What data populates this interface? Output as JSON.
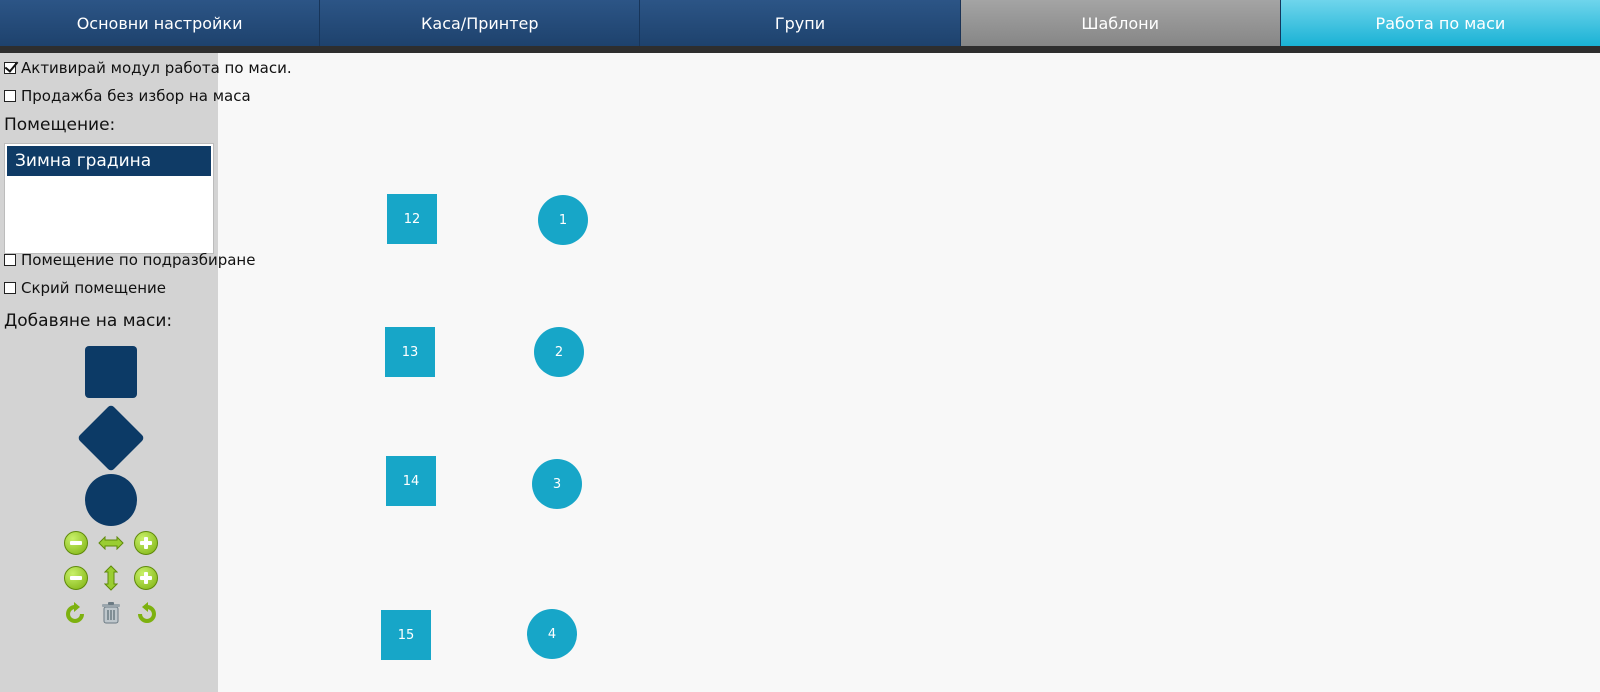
{
  "tabs": [
    {
      "label": "Основни настройки"
    },
    {
      "label": "Каса/Принтер"
    },
    {
      "label": "Групи"
    },
    {
      "label": "Шаблони"
    },
    {
      "label": "Работа по маси"
    }
  ],
  "sidebar": {
    "activate_module": {
      "label": "Активирай модул работа по маси.",
      "checked": true
    },
    "sale_without_table": {
      "label": "Продажба без избор на маса",
      "checked": false
    },
    "room_label": "Помещение:",
    "rooms": [
      "Зимна градина"
    ],
    "selected_room": "Зимна градина",
    "default_room": {
      "label": "Помещение по подразбиране",
      "checked": false
    },
    "hide_room": {
      "label": "Скрий помещение",
      "checked": false
    },
    "add_tables_label": "Добавяне на маси:"
  },
  "tables": {
    "square": [
      "12",
      "13",
      "14",
      "15"
    ],
    "round": [
      "1",
      "2",
      "3",
      "4"
    ]
  },
  "colors": {
    "tab_default": "#2c5586",
    "tab_gray": "#969696",
    "tab_active": "#1ab2d5",
    "table": "#17a6c8",
    "shape": "#0c3a66",
    "sidebar": "#d3d3d3"
  }
}
